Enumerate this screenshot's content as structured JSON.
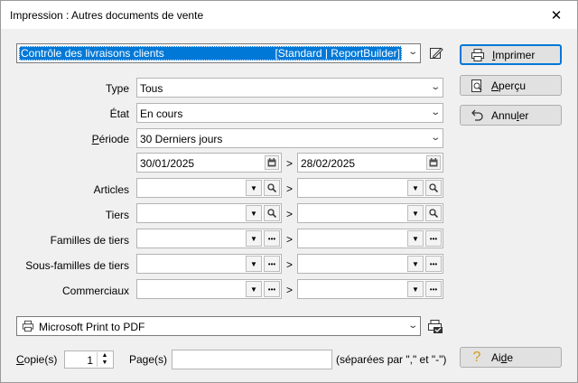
{
  "window": {
    "title": "Impression : Autres documents de vente",
    "close_label": "✕"
  },
  "report": {
    "name": "Contrôle des livraisons clients",
    "tag": "[Standard | ReportBuilder]"
  },
  "buttons": {
    "print": {
      "pre": "",
      "u": "I",
      "post": "mprimer"
    },
    "preview": {
      "pre": "",
      "u": "A",
      "post": "perçu"
    },
    "cancel": {
      "pre": "Annu",
      "u": "l",
      "post": "er"
    },
    "help": {
      "pre": "Ai",
      "u": "d",
      "post": "e"
    }
  },
  "filters": {
    "type": {
      "label": "Type",
      "value": "Tous"
    },
    "etat": {
      "label": "État",
      "value": "En cours"
    },
    "periode": {
      "label_u": "P",
      "label_rest": "ériode",
      "value": "30 Derniers jours"
    },
    "date_from": "30/01/2025",
    "date_to": "28/02/2025",
    "range_sep": ">",
    "rows": [
      {
        "label": "Articles"
      },
      {
        "label": "Tiers"
      },
      {
        "label": "Familles de tiers"
      },
      {
        "label": "Sous-familles de tiers"
      },
      {
        "label": "Commerciaux"
      }
    ]
  },
  "printer": {
    "value": "Microsoft Print to PDF"
  },
  "copies": {
    "label_u": "C",
    "label_rest": "opie(s)",
    "value": "1"
  },
  "pages": {
    "label": "Page(s)",
    "value": "",
    "hint": "(séparées par \",\" et \"-\")"
  },
  "icons": {
    "edit": "edit-icon",
    "printer": "printer-icon",
    "preview": "preview-icon",
    "cancel": "undo-icon",
    "help": "help-icon",
    "calendar": "calendar-icon",
    "search": "search-icon",
    "more": "ellipsis-icon",
    "dropdown": "chevron-down-icon"
  }
}
